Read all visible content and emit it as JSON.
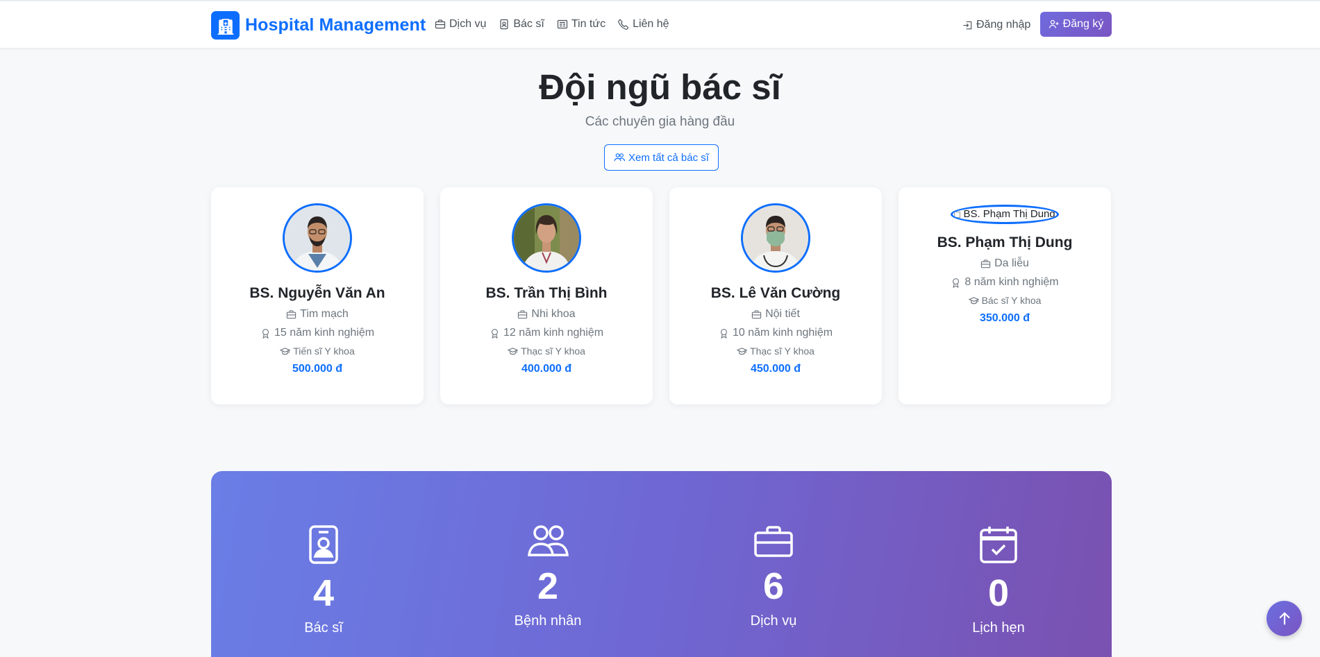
{
  "navbar": {
    "brand": "Hospital Management",
    "links": [
      {
        "label": "Dịch vụ",
        "icon": "briefcase-icon"
      },
      {
        "label": "Bác sĩ",
        "icon": "badge-icon"
      },
      {
        "label": "Tin tức",
        "icon": "newspaper-icon"
      },
      {
        "label": "Liên hệ",
        "icon": "phone-icon"
      }
    ],
    "login": "Đăng nhập",
    "signup": "Đăng ký"
  },
  "section": {
    "title": "Đội ngũ bác sĩ",
    "subtitle": "Các chuyên gia hàng đầu",
    "view_all": "Xem tất cả bác sĩ"
  },
  "doctors": [
    {
      "name": "BS. Nguyễn Văn An",
      "specialty": "Tim mạch",
      "experience": "15 năm kinh nghiệm",
      "degree": "Tiến sĩ Y khoa",
      "price": "500.000 đ"
    },
    {
      "name": "BS. Trần Thị Bình",
      "specialty": "Nhi khoa",
      "experience": "12 năm kinh nghiệm",
      "degree": "Thạc sĩ Y khoa",
      "price": "400.000 đ"
    },
    {
      "name": "BS. Lê Văn Cường",
      "specialty": "Nội tiết",
      "experience": "10 năm kinh nghiệm",
      "degree": "Thạc sĩ Y khoa",
      "price": "450.000 đ"
    },
    {
      "name": "BS. Phạm Thị Dung",
      "alt": "BS. Phạm Thị Dung",
      "specialty": "Da liễu",
      "experience": "8 năm kinh nghiệm",
      "degree": "Bác sĩ Y khoa",
      "price": "350.000 đ"
    }
  ],
  "stats": [
    {
      "value": "4",
      "label": "Bác sĩ",
      "icon": "id-badge-icon"
    },
    {
      "value": "2",
      "label": "Bệnh nhân",
      "icon": "people-icon"
    },
    {
      "value": "6",
      "label": "Dịch vụ",
      "icon": "briefcase-icon"
    },
    {
      "value": "0",
      "label": "Lịch hẹn",
      "icon": "calendar-check-icon"
    }
  ],
  "colors": {
    "primary": "#0d6efd",
    "gradient_start": "#6a7ee6",
    "gradient_end": "#7a51b0"
  }
}
